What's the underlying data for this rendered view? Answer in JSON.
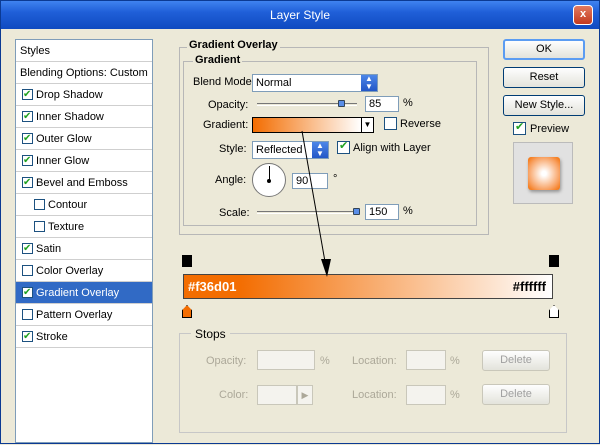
{
  "window": {
    "title": "Layer Style",
    "close_glyph": "x"
  },
  "sidebar": {
    "items": [
      {
        "label": "Styles",
        "checkbox": false,
        "checked": false,
        "selected": false,
        "indent": false
      },
      {
        "label": "Blending Options: Custom",
        "checkbox": false,
        "checked": false,
        "selected": false,
        "indent": false
      },
      {
        "label": "Drop Shadow",
        "checkbox": true,
        "checked": true,
        "selected": false,
        "indent": false
      },
      {
        "label": "Inner Shadow",
        "checkbox": true,
        "checked": true,
        "selected": false,
        "indent": false
      },
      {
        "label": "Outer Glow",
        "checkbox": true,
        "checked": true,
        "selected": false,
        "indent": false
      },
      {
        "label": "Inner Glow",
        "checkbox": true,
        "checked": true,
        "selected": false,
        "indent": false
      },
      {
        "label": "Bevel and Emboss",
        "checkbox": true,
        "checked": true,
        "selected": false,
        "indent": false
      },
      {
        "label": "Contour",
        "checkbox": true,
        "checked": false,
        "selected": false,
        "indent": true
      },
      {
        "label": "Texture",
        "checkbox": true,
        "checked": false,
        "selected": false,
        "indent": true
      },
      {
        "label": "Satin",
        "checkbox": true,
        "checked": true,
        "selected": false,
        "indent": false
      },
      {
        "label": "Color Overlay",
        "checkbox": true,
        "checked": false,
        "selected": false,
        "indent": false
      },
      {
        "label": "Gradient Overlay",
        "checkbox": true,
        "checked": true,
        "selected": true,
        "indent": false
      },
      {
        "label": "Pattern Overlay",
        "checkbox": true,
        "checked": false,
        "selected": false,
        "indent": false
      },
      {
        "label": "Stroke",
        "checkbox": true,
        "checked": true,
        "selected": false,
        "indent": false
      }
    ]
  },
  "gradient_overlay": {
    "section_title": "Gradient Overlay",
    "subsection_title": "Gradient",
    "blend_mode_label": "Blend Mode:",
    "blend_mode_value": "Normal",
    "opacity_label": "Opacity:",
    "opacity_value": "85",
    "opacity_fraction": 0.85,
    "gradient_label": "Gradient:",
    "reverse_label": "Reverse",
    "reverse_checked": false,
    "style_label": "Style:",
    "style_value": "Reflected",
    "align_label": "Align with Layer",
    "align_checked": true,
    "angle_label": "Angle:",
    "angle_value": "90",
    "angle_unit": "°",
    "scale_label": "Scale:",
    "scale_value": "150",
    "scale_fraction": 1.0,
    "percent_unit": "%"
  },
  "gradient_editor": {
    "color_start": "#f36d01",
    "color_end": "#ffffff",
    "label_start": "#f36d01",
    "label_end": "#ffffff"
  },
  "stops": {
    "title": "Stops",
    "opacity_label": "Opacity:",
    "location_label": "Location:",
    "color_label": "Color:",
    "percent_unit": "%",
    "delete_label": "Delete"
  },
  "buttons": {
    "ok": "OK",
    "reset": "Reset",
    "new_style": "New Style...",
    "preview_label": "Preview",
    "preview_checked": true
  },
  "colors": {
    "accent": "#316ac5",
    "gradient_start": "#f36d01",
    "gradient_end": "#ffffff"
  }
}
